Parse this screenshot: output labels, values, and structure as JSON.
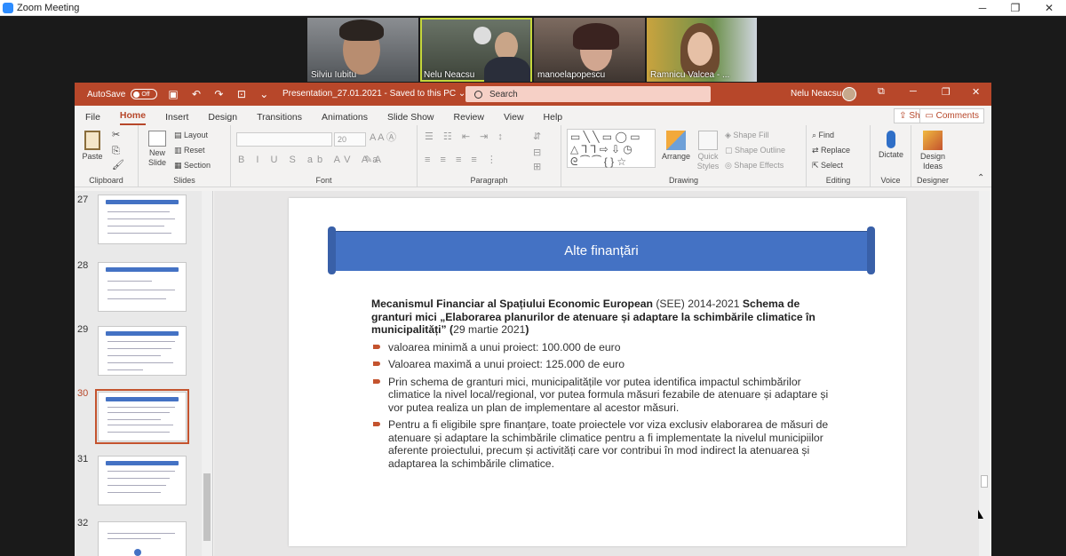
{
  "window": {
    "title": "Zoom Meeting",
    "minimize": "─",
    "maximize": "❐",
    "close": "✕"
  },
  "participants": [
    {
      "name": "Silviu Iubitu"
    },
    {
      "name": "Nelu Neacsu"
    },
    {
      "name": "manoelapopescu"
    },
    {
      "name": "Ramnicu Valcea - ..."
    }
  ],
  "ppt": {
    "autosave_label": "AutoSave",
    "autosave_state": "Off",
    "doc_title": "Presentation_27.01.2021 - Saved to this PC",
    "doc_arrow": "⌄",
    "search_placeholder": "Search",
    "user": "Nelu Neacsu",
    "window_controls": [
      "⧉",
      "─",
      "❐",
      "✕"
    ],
    "tabs": [
      "File",
      "Home",
      "Insert",
      "Design",
      "Transitions",
      "Animations",
      "Slide Show",
      "Review",
      "View",
      "Help"
    ],
    "active_tab": "Home",
    "share": "Share",
    "comments": "Comments",
    "ribbon": {
      "clipboard": "Clipboard",
      "slides": "Slides",
      "font": "Font",
      "paragraph": "Paragraph",
      "drawing": "Drawing",
      "editing": "Editing",
      "voice": "Voice",
      "designer": "Designer",
      "paste": "Paste",
      "new_slide": "New Slide",
      "layout": "Layout",
      "reset": "Reset",
      "section": "Section",
      "font_size": "20",
      "arrange": "Arrange",
      "quick_styles": "Quick Styles",
      "shape_fill": "Shape Fill",
      "shape_outline": "Shape Outline",
      "shape_effects": "Shape Effects",
      "find": "Find",
      "replace": "Replace",
      "select": "Select",
      "dictate": "Dictate",
      "design_ideas": "Design Ideas"
    }
  },
  "thumbnails": [
    {
      "num": "27",
      "selected": false
    },
    {
      "num": "28",
      "selected": false
    },
    {
      "num": "29",
      "selected": false
    },
    {
      "num": "30",
      "selected": true
    },
    {
      "num": "31",
      "selected": false
    },
    {
      "num": "32",
      "selected": false
    }
  ],
  "slide": {
    "title": "Alte finanțări",
    "intro_bold1": "Mecanismul Financiar al Spațiului Economic European",
    "intro_normal1": " (SEE) 2014-2021 ",
    "intro_bold2": "Schema de granturi mici „Elaborarea planurilor de atenuare și adaptare la schimbările climatice în municipalități” (",
    "intro_normal2": "29 martie 2021",
    "intro_bold3": ")",
    "bullets": [
      "valoarea minimă a unui proiect: 100.000 de euro",
      "Valoarea maximă a unui proiect: 125.000 de euro",
      "Prin schema de granturi mici, municipalitățile vor putea identifica impactul schimbărilor climatice la nivel local/regional, vor putea formula măsuri fezabile de atenuare și adaptare și vor putea realiza un plan de implementare al acestor măsuri.",
      "Pentru a fi eligibile spre finanțare, toate proiectele vor viza exclusiv elaborarea de măsuri de atenuare și adaptare la schimbările climatice pentru a fi implementate la nivelul municipiilor aferente proiectului, precum și activități care vor contribui în mod indirect la atenuarea și adaptarea la schimbările climatice."
    ]
  },
  "colors": {
    "accent": "#b7472a",
    "banner": "#4472c4",
    "bullet": "#c4532e"
  }
}
